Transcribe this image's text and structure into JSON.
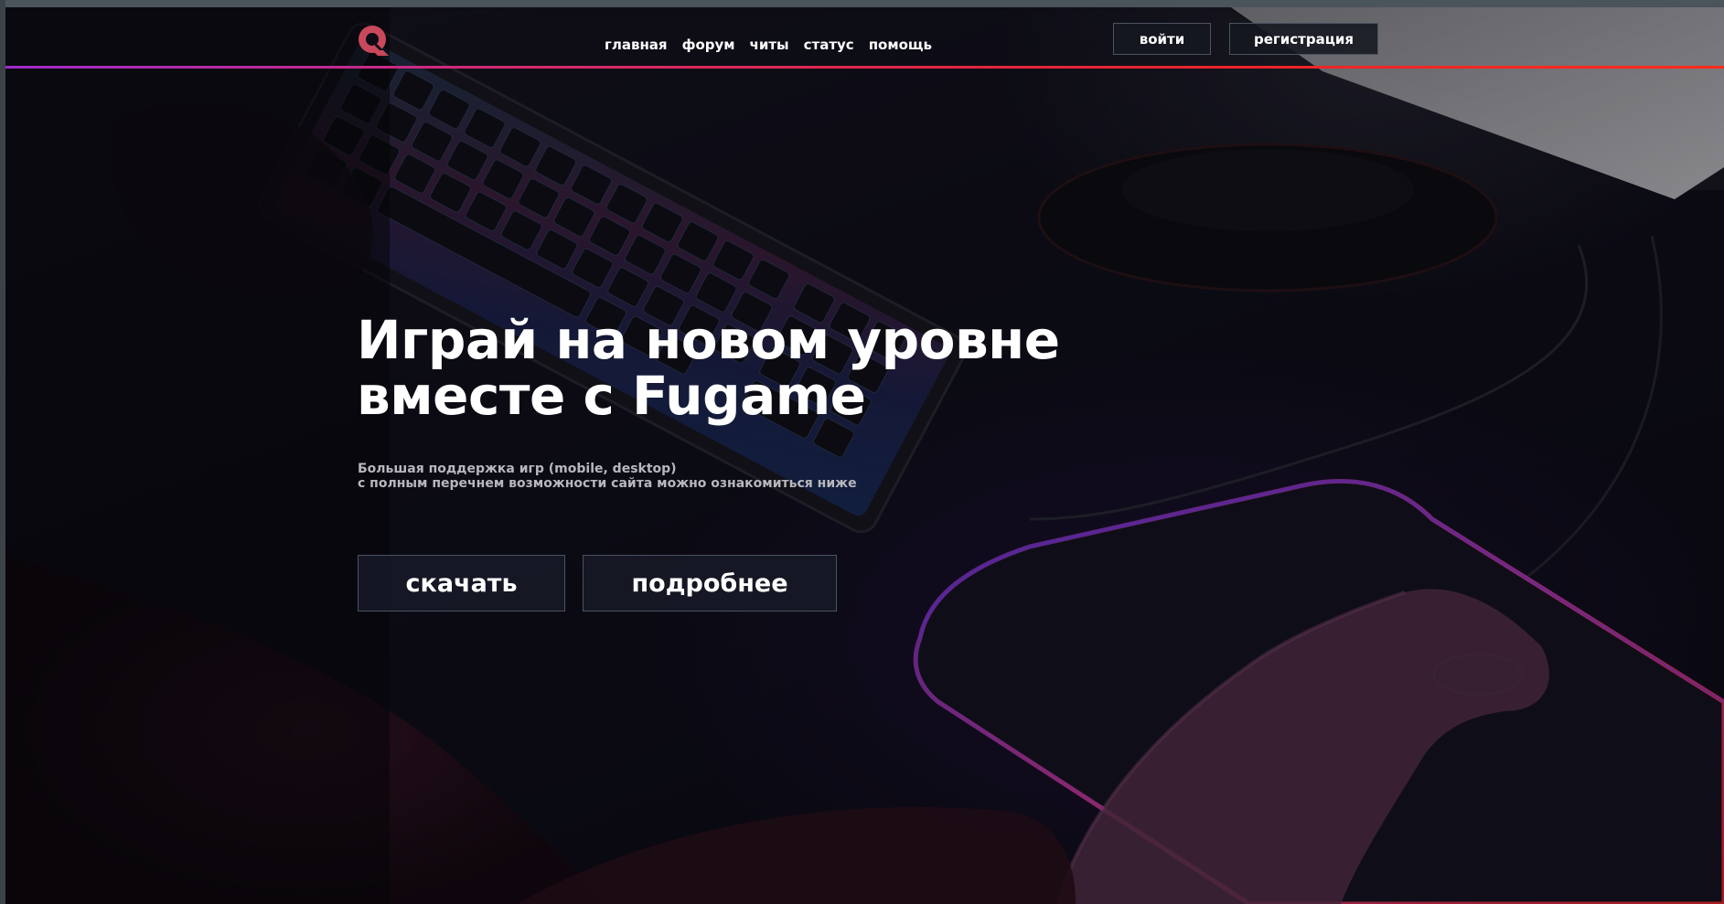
{
  "header": {
    "logo_icon": "fugame-logo-icon",
    "nav": [
      {
        "label": "главная"
      },
      {
        "label": "форум"
      },
      {
        "label": "читы"
      },
      {
        "label": "статус"
      },
      {
        "label": "помощь"
      }
    ],
    "login_label": "войти",
    "register_label": "регистрация"
  },
  "hero": {
    "title_line1": "Играй на новом уровне",
    "title_line2": "вместе с Fugame",
    "subtitle_line1": "Большая поддержка игр (mobile, desktop)",
    "subtitle_line2": "с полным перечнем возможности сайта можно ознакомиться ниже",
    "download_label": "скачать",
    "more_label": "подробнее"
  },
  "colors": {
    "accent_gradient_start": "#a02acc",
    "accent_gradient_end": "#ff2a1a",
    "logo_color": "#c9485c",
    "background": "#0d0c16"
  }
}
